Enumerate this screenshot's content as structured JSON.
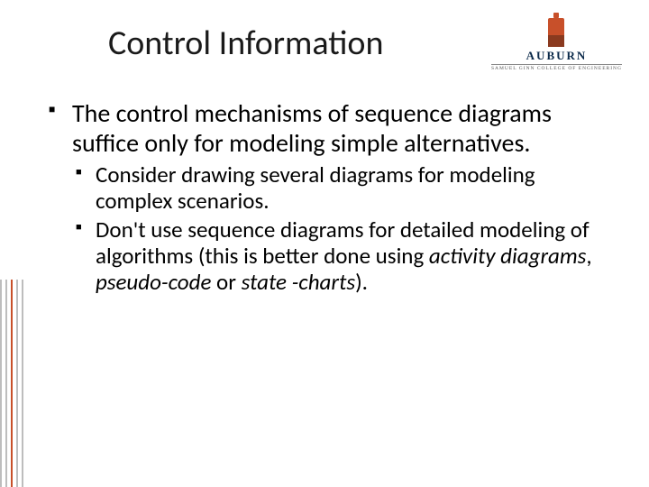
{
  "header": {
    "title": "Control Information",
    "logo": {
      "name": "AUBURN",
      "subline": "SAMUEL GINN COLLEGE OF ENGINEERING"
    }
  },
  "body": {
    "point1": "The control mechanisms of sequence diagrams suffice only for modeling simple alternatives.",
    "sub1": "Consider drawing several diagrams for modeling complex scenarios.",
    "sub2_a": "Don't use sequence diagrams for detailed modeling of algorithms (this is better done using ",
    "sub2_em1": "activity diagrams",
    "sub2_b": ", ",
    "sub2_em2": "pseudo-code",
    "sub2_c": " or ",
    "sub2_em3": "state -charts",
    "sub2_d": ")."
  }
}
